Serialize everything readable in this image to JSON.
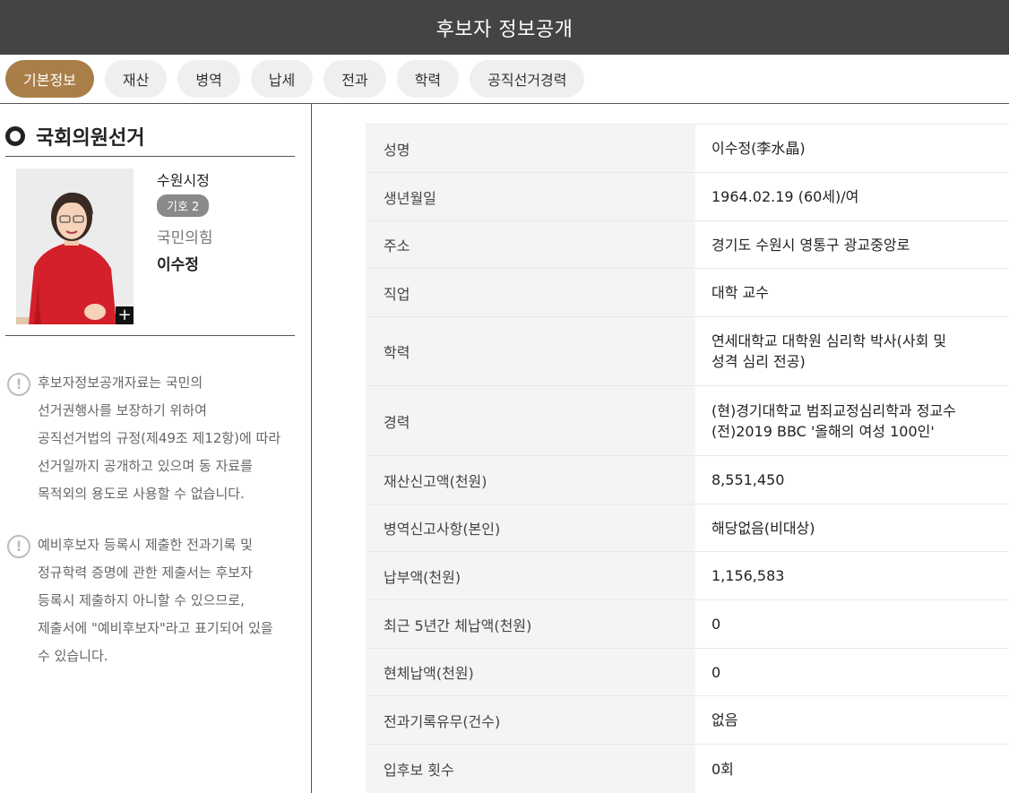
{
  "header": {
    "title": "후보자 정보공개"
  },
  "tabs": [
    {
      "label": "기본정보",
      "active": true
    },
    {
      "label": "재산",
      "active": false
    },
    {
      "label": "병역",
      "active": false
    },
    {
      "label": "납세",
      "active": false
    },
    {
      "label": "전과",
      "active": false
    },
    {
      "label": "학력",
      "active": false
    },
    {
      "label": "공직선거경력",
      "active": false
    }
  ],
  "sidebar": {
    "section_title": "국회의원선거",
    "candidate": {
      "district": "수원시정",
      "number": "기호 2",
      "party": "국민의힘",
      "name": "이수정",
      "expand_symbol": "+"
    },
    "notices": [
      {
        "icon": "exclamation-circle-icon",
        "lines": [
          "후보자정보공개자료는 국민의",
          "선거권행사를 보장하기 위하여",
          "공직선거법의 규정(제49조 제12항)에 따라",
          "선거일까지 공개하고 있으며 동 자료를",
          "목적외의 용도로 사용할 수 없습니다."
        ]
      },
      {
        "icon": "exclamation-circle-icon",
        "lines": [
          "예비후보자 등록시 제출한 전과기록 및",
          "정규학력 증명에 관한 제출서는 후보자",
          "등록시 제출하지 아니할 수 있으므로,",
          "제출서에 \"예비후보자\"라고 표기되어 있을",
          "수 있습니다."
        ]
      }
    ]
  },
  "info_table": [
    {
      "label": "성명",
      "lines": [
        "이수정(李水晶)"
      ]
    },
    {
      "label": "생년월일",
      "lines": [
        "1964.02.19 (60세)/여"
      ]
    },
    {
      "label": "주소",
      "lines": [
        "경기도 수원시 영통구 광교중앙로"
      ]
    },
    {
      "label": "직업",
      "lines": [
        "대학 교수"
      ]
    },
    {
      "label": "학력",
      "lines": [
        "연세대학교 대학원 심리학 박사(사회 및",
        "성격 심리 전공)"
      ]
    },
    {
      "label": "경력",
      "lines": [
        "(현)경기대학교 범죄교정심리학과 정교수",
        "(전)2019 BBC '올해의 여성 100인'"
      ]
    },
    {
      "label": "재산신고액(천원)",
      "lines": [
        "8,551,450"
      ]
    },
    {
      "label": "병역신고사항(본인)",
      "lines": [
        "해당없음(비대상)"
      ]
    },
    {
      "label": "납부액(천원)",
      "lines": [
        "1,156,583"
      ]
    },
    {
      "label": "최근 5년간 체납액(천원)",
      "lines": [
        "0"
      ]
    },
    {
      "label": "현체납액(천원)",
      "lines": [
        "0"
      ]
    },
    {
      "label": "전과기록유무(건수)",
      "lines": [
        "없음"
      ]
    },
    {
      "label": "입후보 횟수",
      "lines": [
        "0회"
      ]
    }
  ]
}
